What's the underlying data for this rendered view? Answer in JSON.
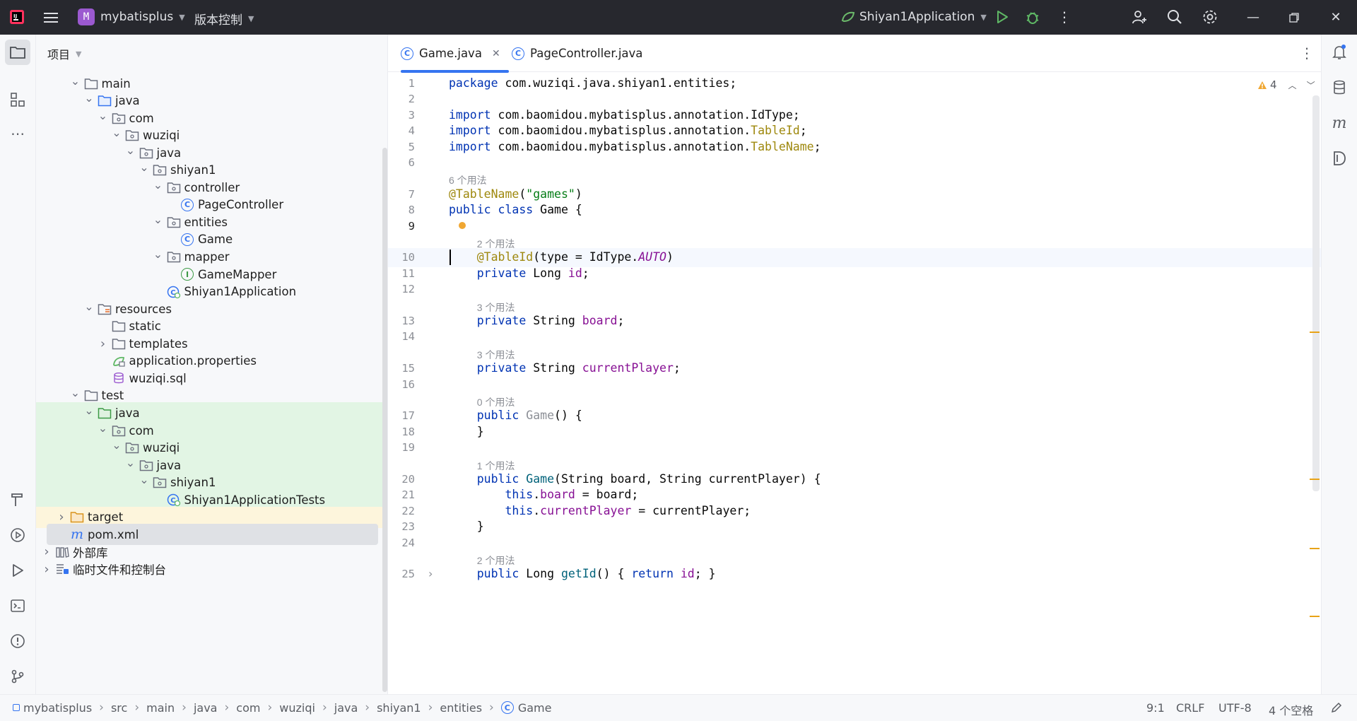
{
  "titlebar": {
    "project_initial": "M",
    "project_name": "mybatisplus",
    "vcs_label": "版本控制",
    "run_config": "Shiyan1Application"
  },
  "project_panel": {
    "title": "项目",
    "tree": [
      {
        "label": "main",
        "icon": "folder-icon",
        "depth": 3,
        "arrow": "expanded"
      },
      {
        "label": "java",
        "icon": "source-folder-icon",
        "depth": 4,
        "arrow": "expanded"
      },
      {
        "label": "com",
        "icon": "package-icon",
        "depth": 5,
        "arrow": "expanded"
      },
      {
        "label": "wuziqi",
        "icon": "package-icon",
        "depth": 6,
        "arrow": "expanded"
      },
      {
        "label": "java",
        "icon": "package-icon",
        "depth": 7,
        "arrow": "expanded"
      },
      {
        "label": "shiyan1",
        "icon": "package-icon",
        "depth": 8,
        "arrow": "expanded"
      },
      {
        "label": "controller",
        "icon": "package-icon",
        "depth": 9,
        "arrow": "expanded"
      },
      {
        "label": "PageController",
        "icon": "class-icon",
        "depth": 10,
        "arrow": "none"
      },
      {
        "label": "entities",
        "icon": "package-icon",
        "depth": 9,
        "arrow": "expanded"
      },
      {
        "label": "Game",
        "icon": "class-icon",
        "depth": 10,
        "arrow": "none"
      },
      {
        "label": "mapper",
        "icon": "package-icon",
        "depth": 9,
        "arrow": "expanded"
      },
      {
        "label": "GameMapper",
        "icon": "interface-icon",
        "depth": 10,
        "arrow": "none"
      },
      {
        "label": "Shiyan1Application",
        "icon": "spring-class-icon",
        "depth": 9,
        "arrow": "none"
      },
      {
        "label": "resources",
        "icon": "resources-folder-icon",
        "depth": 4,
        "arrow": "expanded"
      },
      {
        "label": "static",
        "icon": "folder-icon",
        "depth": 5,
        "arrow": "none"
      },
      {
        "label": "templates",
        "icon": "folder-icon",
        "depth": 5,
        "arrow": "collapsed"
      },
      {
        "label": "application.properties",
        "icon": "spring-config-icon",
        "depth": 5,
        "arrow": "none"
      },
      {
        "label": "wuziqi.sql",
        "icon": "database-icon",
        "depth": 5,
        "arrow": "none"
      },
      {
        "label": "test",
        "icon": "folder-icon",
        "depth": 3,
        "arrow": "expanded"
      },
      {
        "label": "java",
        "icon": "test-folder-icon",
        "depth": 4,
        "arrow": "expanded",
        "highlight": "green"
      },
      {
        "label": "com",
        "icon": "package-icon",
        "depth": 5,
        "arrow": "expanded",
        "highlight": "green"
      },
      {
        "label": "wuziqi",
        "icon": "package-icon",
        "depth": 6,
        "arrow": "expanded",
        "highlight": "green"
      },
      {
        "label": "java",
        "icon": "package-icon",
        "depth": 7,
        "arrow": "expanded",
        "highlight": "green"
      },
      {
        "label": "shiyan1",
        "icon": "package-icon",
        "depth": 8,
        "arrow": "expanded",
        "highlight": "green"
      },
      {
        "label": "Shiyan1ApplicationTests",
        "icon": "spring-class-icon",
        "depth": 9,
        "arrow": "none",
        "highlight": "green"
      },
      {
        "label": "target",
        "icon": "excluded-folder-icon",
        "depth": 2,
        "arrow": "collapsed",
        "highlight": "yellow"
      },
      {
        "label": "pom.xml",
        "icon": "maven-icon",
        "depth": 2,
        "arrow": "none",
        "highlight": "selected"
      },
      {
        "label": "外部库",
        "icon": "library-icon",
        "depth": 1,
        "arrow": "collapsed"
      },
      {
        "label": "临时文件和控制台",
        "icon": "scratch-icon",
        "depth": 1,
        "arrow": "collapsed"
      }
    ]
  },
  "editor": {
    "tabs": [
      {
        "label": "Game.java",
        "active": true
      },
      {
        "label": "PageController.java",
        "active": false
      }
    ],
    "warning_count": "4",
    "rows": [
      {
        "kind": "code",
        "num": "1",
        "html": "<span class=\"kw\">package</span> com.wuziqi.java.shiyan1.entities;"
      },
      {
        "kind": "code",
        "num": "2",
        "html": ""
      },
      {
        "kind": "code",
        "num": "3",
        "html": "<span class=\"kw\">import</span> com.baomidou.mybatisplus.annotation.IdType;"
      },
      {
        "kind": "code",
        "num": "4",
        "html": "<span class=\"kw\">import</span> com.baomidou.mybatisplus.annotation.<span class=\"an\">TableId</span>;"
      },
      {
        "kind": "code",
        "num": "5",
        "html": "<span class=\"kw\">import</span> com.baomidou.mybatisplus.annotation.<span class=\"an\">TableName</span>;"
      },
      {
        "kind": "code",
        "num": "6",
        "html": ""
      },
      {
        "kind": "hint",
        "text": "6 个用法",
        "indent": 0
      },
      {
        "kind": "code",
        "num": "7",
        "html": "<span class=\"an\">@TableName</span>(<span class=\"st\">\"games\"</span>)"
      },
      {
        "kind": "code",
        "num": "8",
        "html": "<span class=\"kw\">public class</span> Game {"
      },
      {
        "kind": "code",
        "num": "9",
        "html": "",
        "current": true
      },
      {
        "kind": "hint",
        "text": "2 个用法",
        "indent": 4
      },
      {
        "kind": "code",
        "num": "10",
        "html": "    <span class=\"an\">@TableId</span>(type = IdType.<span class=\"it\">AUTO</span>)"
      },
      {
        "kind": "code",
        "num": "11",
        "html": "    <span class=\"kw\">private</span> Long <span class=\"fd\">id</span>;"
      },
      {
        "kind": "code",
        "num": "12",
        "html": ""
      },
      {
        "kind": "hint",
        "text": "3 个用法",
        "indent": 4
      },
      {
        "kind": "code",
        "num": "13",
        "html": "    <span class=\"kw\">private</span> String <span class=\"fd\">board</span>;"
      },
      {
        "kind": "code",
        "num": "14",
        "html": ""
      },
      {
        "kind": "hint",
        "text": "3 个用法",
        "indent": 4
      },
      {
        "kind": "code",
        "num": "15",
        "html": "    <span class=\"kw\">private</span> String <span class=\"fd\">currentPlayer</span>;"
      },
      {
        "kind": "code",
        "num": "16",
        "html": ""
      },
      {
        "kind": "hint",
        "text": "0 个用法",
        "indent": 4
      },
      {
        "kind": "code",
        "num": "17",
        "html": "    <span class=\"kw\">public</span> <span class=\"gr\">Game</span>() {"
      },
      {
        "kind": "code",
        "num": "18",
        "html": "    }"
      },
      {
        "kind": "code",
        "num": "19",
        "html": ""
      },
      {
        "kind": "hint",
        "text": "1 个用法",
        "indent": 4
      },
      {
        "kind": "code",
        "num": "20",
        "html": "    <span class=\"kw\">public</span> <span class=\"mt\">Game</span>(String board, String currentPlayer) {"
      },
      {
        "kind": "code",
        "num": "21",
        "html": "        <span class=\"kw\">this</span>.<span class=\"fd\">board</span> = board;"
      },
      {
        "kind": "code",
        "num": "22",
        "html": "        <span class=\"kw\">this</span>.<span class=\"fd\">currentPlayer</span> = currentPlayer;"
      },
      {
        "kind": "code",
        "num": "23",
        "html": "    }"
      },
      {
        "kind": "code",
        "num": "24",
        "html": ""
      },
      {
        "kind": "hint",
        "text": "2 个用法",
        "indent": 4
      },
      {
        "kind": "code",
        "num": "25",
        "html": "    <span class=\"kw\">public</span> Long <span class=\"mt\">getId</span>() { <span class=\"kw\">return</span> <span class=\"fd\">id</span>; }"
      }
    ]
  },
  "statusbar": {
    "breadcrumbs": [
      "mybatisplus",
      "src",
      "main",
      "java",
      "com",
      "wuziqi",
      "java",
      "shiyan1",
      "entities",
      "Game"
    ],
    "position": "9:1",
    "line_sep": "CRLF",
    "encoding": "UTF-8",
    "indent": "4 个空格"
  },
  "colors": {
    "accent": "#3574f0",
    "titlebar_bg": "#27282e",
    "test_highlight": "#e2f5e4",
    "excluded_highlight": "#fdf5dc"
  }
}
